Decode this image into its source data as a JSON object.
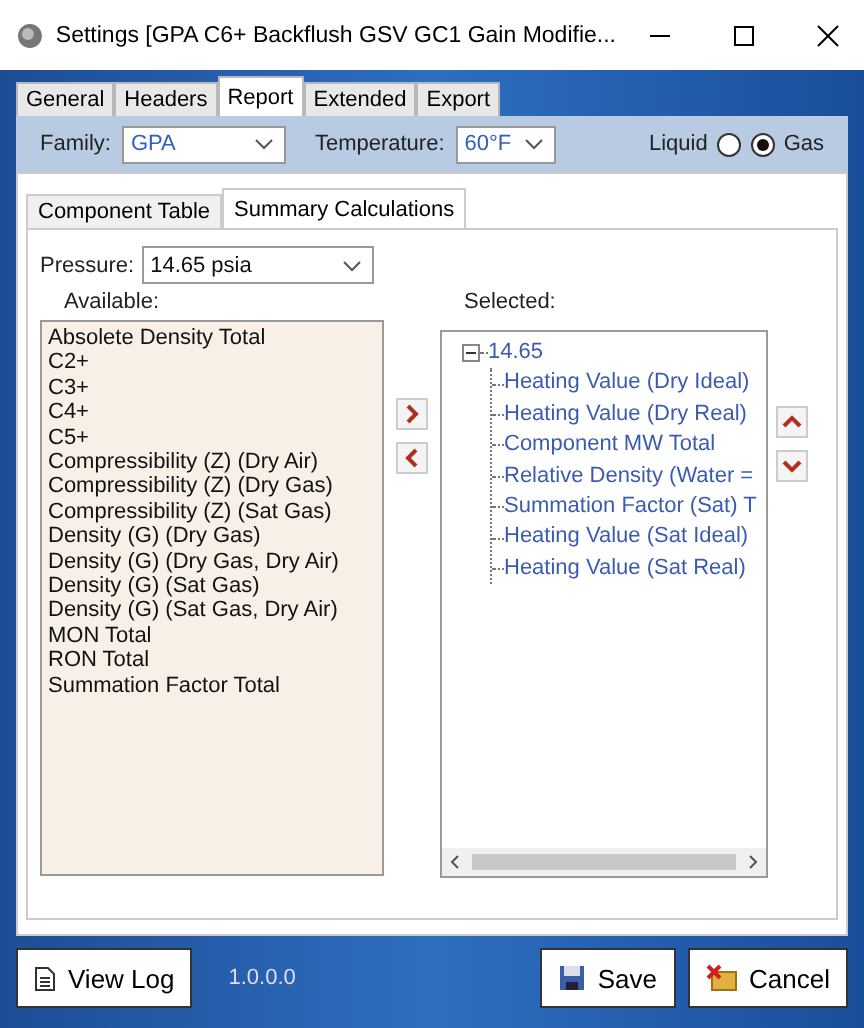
{
  "window": {
    "title": "Settings [GPA C6+ Backflush GSV GC1 Gain Modifie..."
  },
  "tabs": [
    {
      "label": "General",
      "selected": false
    },
    {
      "label": "Headers",
      "selected": false
    },
    {
      "label": "Report",
      "selected": true
    },
    {
      "label": "Extended",
      "selected": false
    },
    {
      "label": "Export",
      "selected": false
    }
  ],
  "report_bar": {
    "family_label": "Family:",
    "family_value": "GPA",
    "temperature_label": "Temperature:",
    "temperature_value": "60°F",
    "phase": [
      {
        "label": "Liquid",
        "selected": false
      },
      {
        "label": "Gas",
        "selected": true
      }
    ]
  },
  "sub_tabs": [
    {
      "label": "Component Table",
      "selected": false
    },
    {
      "label": "Summary Calculations",
      "selected": true
    }
  ],
  "pressure": {
    "label": "Pressure:",
    "value": "14.65 psia"
  },
  "available": {
    "label": "Available:",
    "items": [
      "Absolete Density Total",
      "C2+",
      "C3+",
      "C4+",
      "C5+",
      "Compressibility (Z) (Dry Air)",
      "Compressibility (Z) (Dry Gas)",
      "Compressibility (Z) (Sat Gas)",
      "Density (G) (Dry Gas)",
      "Density (G) (Dry Gas, Dry Air)",
      "Density (G) (Sat Gas)",
      "Density (G) (Sat Gas, Dry Air)",
      "MON Total",
      "RON Total",
      "Summation Factor Total"
    ]
  },
  "selected": {
    "label": "Selected:",
    "tree": [
      {
        "label": "14.65",
        "expanded": true,
        "children": [
          {
            "label": "Heating Value (Dry Ideal)"
          },
          {
            "label": "Heating Value (Dry Real)"
          },
          {
            "label": "Component MW Total"
          },
          {
            "label": "Relative Density (Water ="
          },
          {
            "label": "Summation Factor (Sat) T"
          },
          {
            "label": "Heating Value (Sat Ideal)"
          },
          {
            "label": "Heating Value (Sat Real)"
          }
        ]
      }
    ]
  },
  "footer": {
    "view_log": "View Log",
    "version": "1.0.0.0",
    "save": "Save",
    "cancel": "Cancel"
  }
}
